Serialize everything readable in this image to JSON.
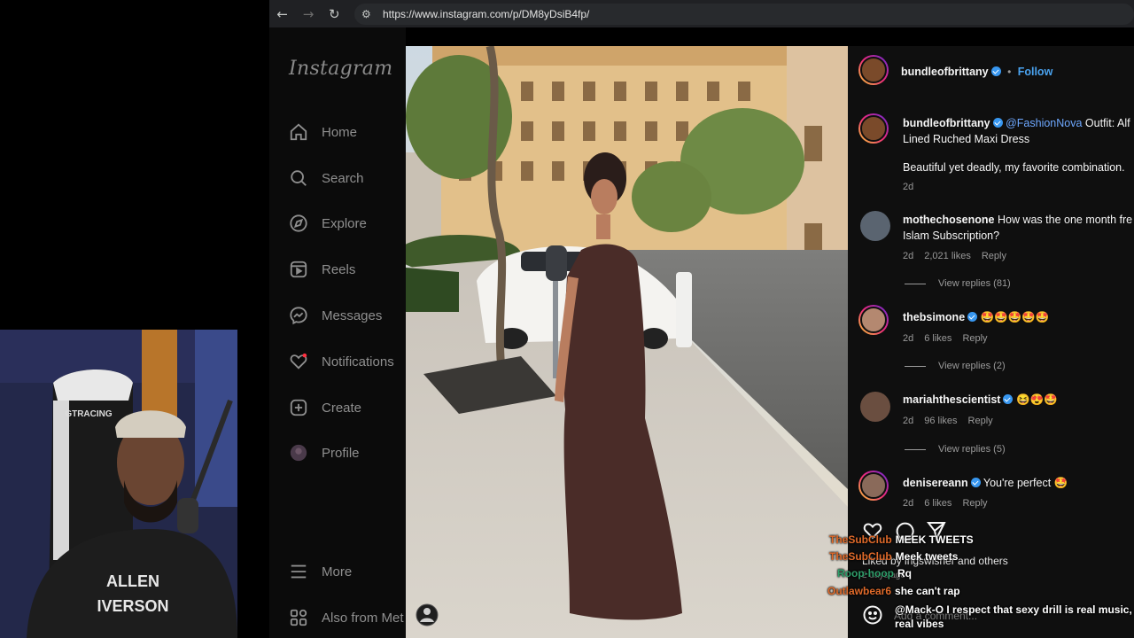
{
  "browser": {
    "url": "https://www.instagram.com/p/DM8yDsiB4fp/",
    "back_icon": "back-arrow-icon",
    "forward_icon": "forward-arrow-icon",
    "reload_icon": "reload-icon",
    "site_info_icon": "site-settings-icon"
  },
  "instagram": {
    "logo": "Instagram",
    "nav": [
      {
        "label": "Home",
        "icon": "home-icon"
      },
      {
        "label": "Search",
        "icon": "search-icon"
      },
      {
        "label": "Explore",
        "icon": "compass-icon"
      },
      {
        "label": "Reels",
        "icon": "reels-icon"
      },
      {
        "label": "Messages",
        "icon": "messenger-icon"
      },
      {
        "label": "Notifications",
        "icon": "heart-icon"
      },
      {
        "label": "Create",
        "icon": "plus-square-icon"
      },
      {
        "label": "Profile",
        "icon": "avatar"
      },
      {
        "label": "More",
        "icon": "hamburger-icon"
      },
      {
        "label": "Also from Met",
        "icon": "grid-icon"
      }
    ]
  },
  "post": {
    "author": "bundleofbrittany",
    "follow_label": "Follow",
    "separator": "•",
    "caption": {
      "author": "bundleofbrittany",
      "mention": "@FashionNova",
      "text_line1": " Outfit: Alf",
      "text_line2": "Lined Ruched Maxi Dress",
      "text_line3": "Beautiful yet deadly, my favorite combination.",
      "time": "2d"
    },
    "comments": [
      {
        "user": "mothechosenone",
        "verified": false,
        "text": " How was the one month fre",
        "text2": "Islam Subscription?",
        "time": "2d",
        "likes": "2,021 likes",
        "reply": "Reply",
        "view_replies": "View replies (81)"
      },
      {
        "user": "thebsimone",
        "verified": true,
        "text": " 🤩🤩🤩🤩🤩",
        "time": "2d",
        "likes": "6 likes",
        "reply": "Reply",
        "view_replies": "View replies (2)"
      },
      {
        "user": "mariahthescientist",
        "verified": true,
        "text": " 😆😍🤩",
        "time": "2d",
        "likes": "96 likes",
        "reply": "Reply",
        "view_replies": "View replies (5)"
      },
      {
        "user": "denisereann",
        "verified": true,
        "text": " You're perfect 🤩",
        "time": "2d",
        "likes": "6 likes",
        "reply": "Reply"
      }
    ],
    "liked_by": "Liked by ingswisher and others",
    "days_ago": "2 days ago",
    "add_comment": "Add a comment..."
  },
  "chat": [
    {
      "user": "TheSubClub",
      "message": "MEEK TWEETS",
      "color": "#e06a2a"
    },
    {
      "user": "TheSubClub",
      "message": "Meek tweets",
      "color": "#e06a2a"
    },
    {
      "user": "Roop-hoop",
      "message": "Rq",
      "color": "#2f9e6a"
    },
    {
      "user": "Outlawbear6",
      "message": "she can't rap",
      "color": "#e06a2a"
    },
    {
      "user": "",
      "message": "@Mack-O I respect that sexy drill is real music,",
      "message2": "real vibes",
      "color": "#e06a2a"
    }
  ],
  "webcam": {
    "shirt_line1": "ALLEN",
    "shirt_line2": "IVERSON",
    "chair_brand": "GTRACING"
  }
}
